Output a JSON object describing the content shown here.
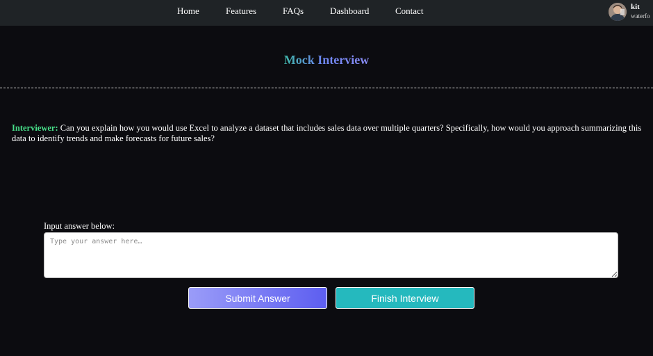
{
  "nav": {
    "links": [
      "Home",
      "Features",
      "FAQs",
      "Dashboard",
      "Contact"
    ]
  },
  "user": {
    "name": "kit",
    "subtitle": "waterfo"
  },
  "page": {
    "title": "Mock Interview"
  },
  "question": {
    "speaker": "Interviewer:",
    "text": "Can you explain how you would use Excel to analyze a dataset that includes sales data over multiple quarters? Specifically, how would you approach summarizing this data to identify trends and make forecasts for future sales?"
  },
  "answer": {
    "label": "Input answer below:",
    "placeholder": "Type your answer here…",
    "value": ""
  },
  "buttons": {
    "submit": "Submit Answer",
    "finish": "Finish Interview"
  },
  "colors": {
    "navbar_bg": "#1f2326",
    "page_bg": "#0c0c10",
    "speaker": "#48e08a",
    "submit_start": "#9a9cf8",
    "submit_end": "#5d5ef0",
    "finish": "#25b9be"
  }
}
